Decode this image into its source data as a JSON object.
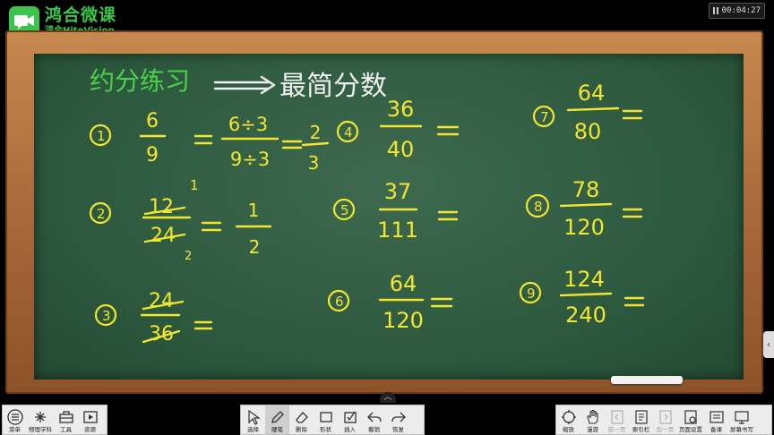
{
  "app": {
    "logo_cn": "鸿合微课",
    "logo_en": "鸿合HiteVision"
  },
  "timer": {
    "time": "00:04:27"
  },
  "board": {
    "title": "约分练习",
    "title_target": "最简分数",
    "problems": [
      {
        "num": "1",
        "numerator": "6",
        "denominator": "9",
        "work": "6÷3 / 9÷3 = 2/3"
      },
      {
        "num": "2",
        "numerator": "12",
        "denominator": "24",
        "work": "1/2"
      },
      {
        "num": "3",
        "numerator": "24",
        "denominator": "36",
        "work": ""
      },
      {
        "num": "4",
        "numerator": "36",
        "denominator": "40",
        "work": ""
      },
      {
        "num": "5",
        "numerator": "37",
        "denominator": "111",
        "work": ""
      },
      {
        "num": "6",
        "numerator": "64",
        "denominator": "120",
        "work": ""
      },
      {
        "num": "7",
        "numerator": "64",
        "denominator": "80",
        "work": ""
      },
      {
        "num": "8",
        "numerator": "78",
        "denominator": "120",
        "work": ""
      },
      {
        "num": "9",
        "numerator": "124",
        "denominator": "240",
        "work": ""
      }
    ]
  },
  "toolbar_left": [
    {
      "label": "菜单",
      "icon": "menu-icon"
    },
    {
      "label": "物理学科",
      "icon": "physics-icon"
    },
    {
      "label": "工具",
      "icon": "toolbox-icon"
    },
    {
      "label": "资源",
      "icon": "resource-icon"
    }
  ],
  "toolbar_center": [
    {
      "label": "选择",
      "icon": "select-cursor-icon"
    },
    {
      "label": "硬笔",
      "icon": "pen-icon"
    },
    {
      "label": "删除",
      "icon": "eraser-icon"
    },
    {
      "label": "形状",
      "icon": "shape-icon"
    },
    {
      "label": "插入",
      "icon": "insert-icon"
    },
    {
      "label": "撤销",
      "icon": "undo-icon"
    },
    {
      "label": "恢复",
      "icon": "redo-icon"
    }
  ],
  "toolbar_right": [
    {
      "label": "缩放",
      "icon": "zoom-icon"
    },
    {
      "label": "漫游",
      "icon": "hand-icon"
    },
    {
      "label": "前一页",
      "icon": "prev-page-icon"
    },
    {
      "label": "索引栏",
      "icon": "index-icon"
    },
    {
      "label": "后一页",
      "icon": "next-page-icon"
    },
    {
      "label": "页面设置",
      "icon": "page-settings-icon"
    },
    {
      "label": "备课",
      "icon": "lesson-prep-icon"
    },
    {
      "label": "屏幕书写",
      "icon": "screen-write-icon"
    }
  ],
  "colors": {
    "chalk_yellow": "#f4e530",
    "chalk_green": "#4bd248",
    "board": "#2d5a3f",
    "frame": "#a9693a",
    "brand_green": "#3cc44a"
  }
}
